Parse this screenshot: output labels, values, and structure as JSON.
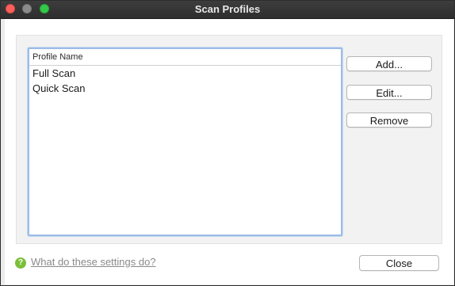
{
  "window": {
    "title": "Scan Profiles"
  },
  "list": {
    "header": "Profile Name",
    "items": [
      "Full Scan",
      "Quick Scan"
    ]
  },
  "buttons": {
    "add": "Add...",
    "edit": "Edit...",
    "remove": "Remove",
    "close": "Close"
  },
  "help": {
    "icon": "question-mark-icon",
    "link_text": "What do these settings do?"
  },
  "colors": {
    "title_bar": "#2e2e2e",
    "list_focus_border": "#9dbde6",
    "help_icon": "#7cbf3a",
    "traffic_close": "#fc605c",
    "traffic_minimize": "#8c8c8c",
    "traffic_zoom": "#34c84a"
  }
}
